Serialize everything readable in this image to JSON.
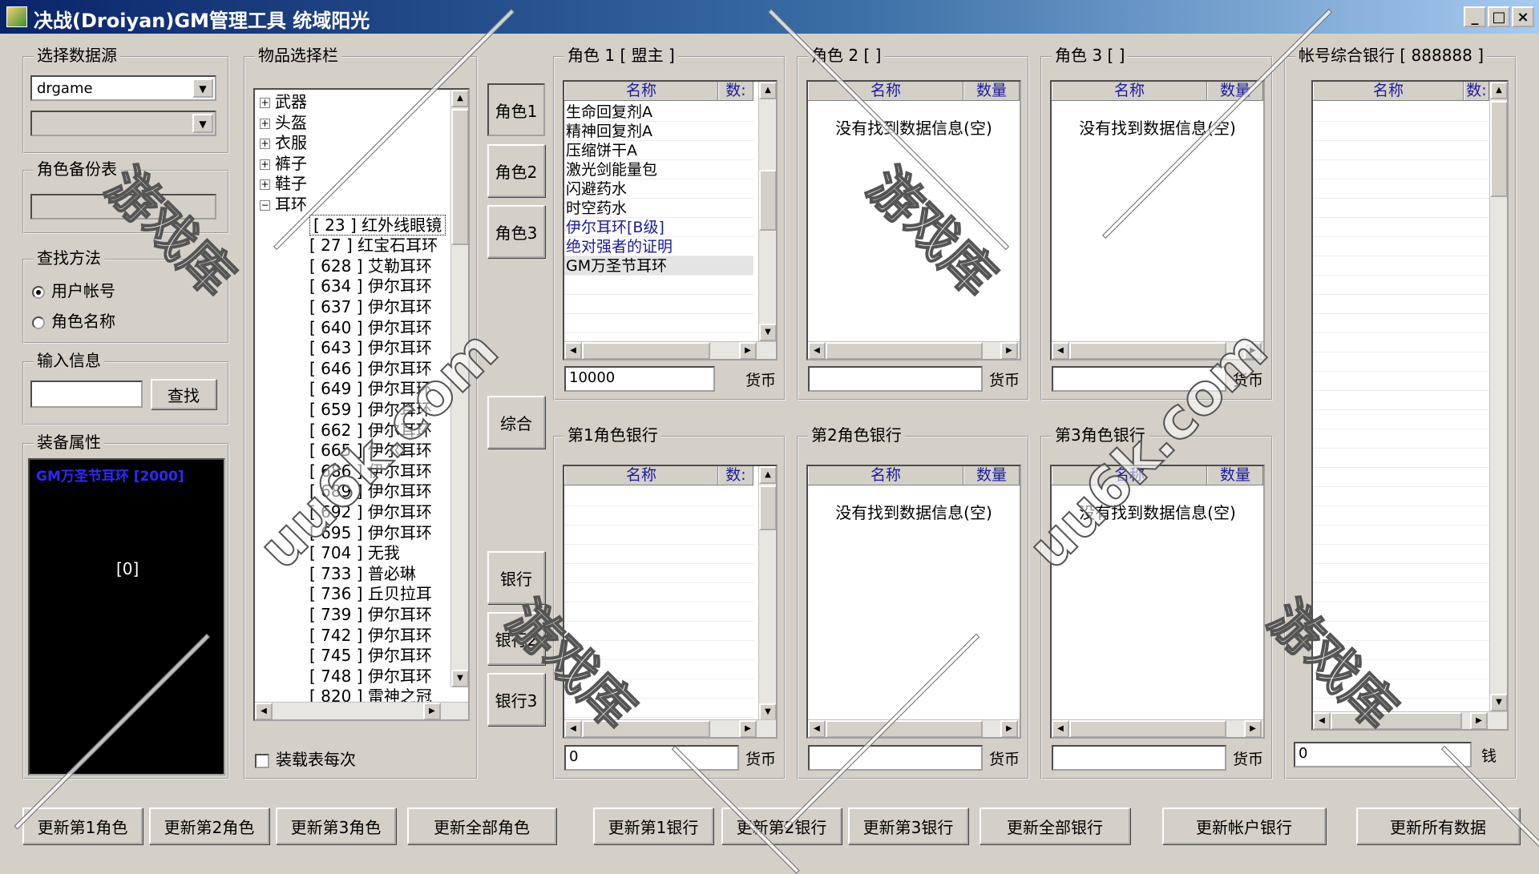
{
  "window": {
    "title": "决战(Droiyan)GM管理工具 统域阳光"
  },
  "datasource": {
    "group_title": "选择数据源",
    "selected": "drgame"
  },
  "backup": {
    "group_title": "角色备份表"
  },
  "search_method": {
    "group_title": "查找方法",
    "options": [
      "用户帐号",
      "角色名称"
    ]
  },
  "input": {
    "group_title": "输入信息",
    "button": "查找"
  },
  "equip": {
    "group_title": "装备属性",
    "title_line": "GM万圣节耳环 [2000]",
    "value": "[0]"
  },
  "items": {
    "group_title": "物品选择栏",
    "categories": [
      "武器",
      "头盔",
      "衣服",
      "裤子",
      "鞋子",
      "耳环"
    ],
    "children": [
      {
        "id": "[ 23 ]",
        "name": "红外线眼镜"
      },
      {
        "id": "[ 27 ]",
        "name": "红宝石耳环"
      },
      {
        "id": "[ 628 ]",
        "name": "艾勒耳环"
      },
      {
        "id": "[ 634 ]",
        "name": "伊尔耳环"
      },
      {
        "id": "[ 637 ]",
        "name": "伊尔耳环"
      },
      {
        "id": "[ 640 ]",
        "name": "伊尔耳环"
      },
      {
        "id": "[ 643 ]",
        "name": "伊尔耳环"
      },
      {
        "id": "[ 646 ]",
        "name": "伊尔耳环"
      },
      {
        "id": "[ 649 ]",
        "name": "伊尔耳环"
      },
      {
        "id": "[ 659 ]",
        "name": "伊尔耳环"
      },
      {
        "id": "[ 662 ]",
        "name": "伊尔耳环"
      },
      {
        "id": "[ 665 ]",
        "name": "伊尔耳环"
      },
      {
        "id": "[ 686 ]",
        "name": "伊尔耳环"
      },
      {
        "id": "[ 689 ]",
        "name": "伊尔耳环"
      },
      {
        "id": "[ 692 ]",
        "name": "伊尔耳环"
      },
      {
        "id": "[ 695 ]",
        "name": "伊尔耳环"
      },
      {
        "id": "[ 704 ]",
        "name": "无我"
      },
      {
        "id": "[ 733 ]",
        "name": "普必琳"
      },
      {
        "id": "[ 736 ]",
        "name": "丘贝拉耳"
      },
      {
        "id": "[ 739 ]",
        "name": "伊尔耳环"
      },
      {
        "id": "[ 742 ]",
        "name": "伊尔耳环"
      },
      {
        "id": "[ 745 ]",
        "name": "伊尔耳环"
      },
      {
        "id": "[ 748 ]",
        "name": "伊尔耳环"
      },
      {
        "id": "[ 820 ]",
        "name": "雷神之冠"
      }
    ],
    "checkbox_label": "装载表每次"
  },
  "side_buttons": [
    "角色1",
    "角色2",
    "角色3",
    "综合",
    "银行",
    "银行2",
    "银行3"
  ],
  "columns": {
    "name": "名称",
    "qty": "数量",
    "qty_short": "数:"
  },
  "currency_label": "货币",
  "money_label": "钱",
  "empty_message": "没有找到数据信息(空)",
  "char1": {
    "title": "角色 1 [ 盟主 ]",
    "items": [
      "生命回复剂A",
      "精神回复剂A",
      "压缩饼干A",
      "激光剑能量包",
      "闪避药水",
      "时空药水",
      "伊尔耳环[B级]",
      "绝对强者的证明",
      "GM万圣节耳环"
    ],
    "money": "10000"
  },
  "char2": {
    "title": "角色 2 [ ]",
    "money": ""
  },
  "char3": {
    "title": "角色 3 [ ]",
    "money": ""
  },
  "account_bank": {
    "title": "帐号综合银行 [ 888888 ]",
    "money": "0"
  },
  "bank1": {
    "title": "第1角色银行",
    "money": "0"
  },
  "bank2": {
    "title": "第2角色银行",
    "money": ""
  },
  "bank3": {
    "title": "第3角色银行",
    "money": ""
  },
  "bottom_buttons": [
    "更新第1角色",
    "更新第2角色",
    "更新第3角色",
    "更新全部角色",
    "更新第1银行",
    "更新第2银行",
    "更新第3银行",
    "更新全部银行",
    "更新帐户银行",
    "更新所有数据"
  ],
  "watermarks": {
    "brand": "游戏库",
    "url": "uu6k.com"
  }
}
